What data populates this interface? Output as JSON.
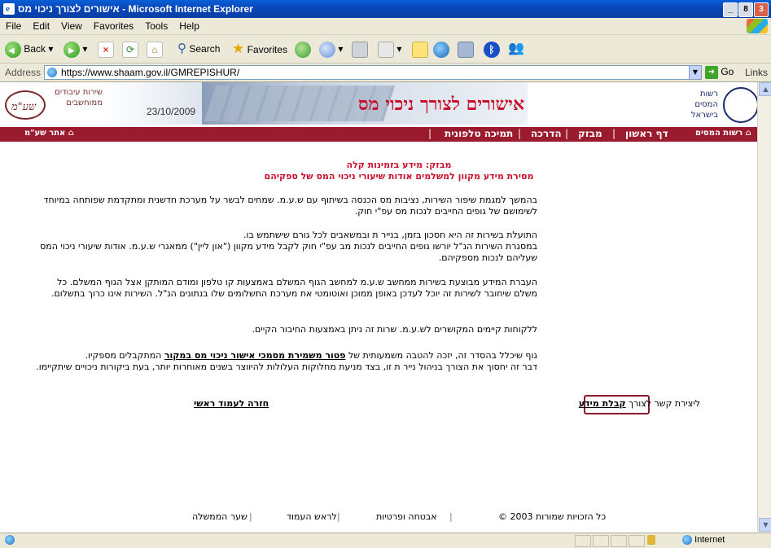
{
  "window": {
    "title": "אישורים לצורך ניכוי מס - Microsoft Internet Explorer",
    "buttons": [
      "_",
      "8",
      "3"
    ]
  },
  "menu": [
    "File",
    "Edit",
    "View",
    "Favorites",
    "Tools",
    "Help"
  ],
  "toolbar": {
    "back": "Back",
    "search": "Search",
    "favorites": "Favorites"
  },
  "address": {
    "label": "Address",
    "url": "https://www.shaam.gov.il/GMREPISHUR/",
    "go": "Go",
    "links": "Links"
  },
  "header": {
    "title": "אישורים לצורך ניכוי מס",
    "date": "23/10/2009",
    "left_logo_text": "שירות עיבודים ממוחשבים",
    "left_logo_glyph": "שע\"מ",
    "right_logo_text": "רשות המסים בישראל"
  },
  "nav": {
    "tax_authority": "רשות המסים",
    "home": "דף ראשון",
    "mivzak": "מבזק",
    "guidance": "הדרכה",
    "phone_support": "תמיכה טלפונית",
    "shaam_site": "אתר שע\"מ"
  },
  "content": {
    "heading1": "מבזק: מידע בזמינות קלה",
    "heading2": "מסירת מידע מקוון למשלמים אודות שיעורי ניכוי המס של ספקיהם",
    "p1": "בהמשך למגמת שיפור השירות, נציבות מס הכנסה בשיתוף עם ש.ע.מ. שמחים לבשר על מערכת חדשנית ומתקדמת שפותחה במיוחד לשימושם של גופים החייבים לנכות מס עפ\"י חוק.",
    "p2a": "התועלת בשירות זה היא חסכון בזמן, בנייר ת ובמשאבים לכל גורם שישתמש בו.",
    "p2b": "במסגרת השירות הנ\"ל יורשו גופים החייבים לנכות מב עפ\"י חוק לקבל מידע מקוון (\"און ליין\") ממאגרי ש.ע.מ. אודות שיעורי ניכוי המס שעליהם לנכות מספקיהם.",
    "p3": "העברת המידע מבוצעת בשירות ממחשב ש.ע.מ למחשב הגוף המשלם באמצעות קו טלפון ומודם המותקן אצל הגוף המשלם. כל משלם שיחובר לשירות זה יוכל לעדכן באופן ממוכן ואוטומטי את מערכת התשלומים שלו בנתונים הנ\"ל. השירות אינו כרוך בתשלום.",
    "p4": "ללקוחות קיימים המקושרים לש.ע.מ. שרות זה ניתן באמצעות החיבור הקיים.",
    "p5_pre": "גוף שיכלל בהסדר זה, יזכה להטבה משמעותית של",
    "p5_link": "פטור משמירת מסמכי אישור ניכוי מס במקור",
    "p5_post": "המתקבלים מספקיו.",
    "p6": "דבר זה יחסוך את הצורך בניהול נייר ת זו, בצד מניעת מחלוקות העלולות להיווצר בשנים מאוחרות יותר, בעת ביקורות ניכויים שיתקיימו.",
    "contact_pre": "ליצירת קשר לצורך",
    "contact_link": "קבלת מידע",
    "back_link": "חזרה לעמוד ראשי"
  },
  "footer": {
    "copyright": "© כל הזכויות שמורות 2003",
    "privacy": "אבטחה ופרטיות",
    "top": "לראש העמוד",
    "gov": "שער הממשלה"
  },
  "status": {
    "zone": "Internet"
  },
  "colors": {
    "accent": "#9b1b2e",
    "title_red": "#c8102e"
  }
}
